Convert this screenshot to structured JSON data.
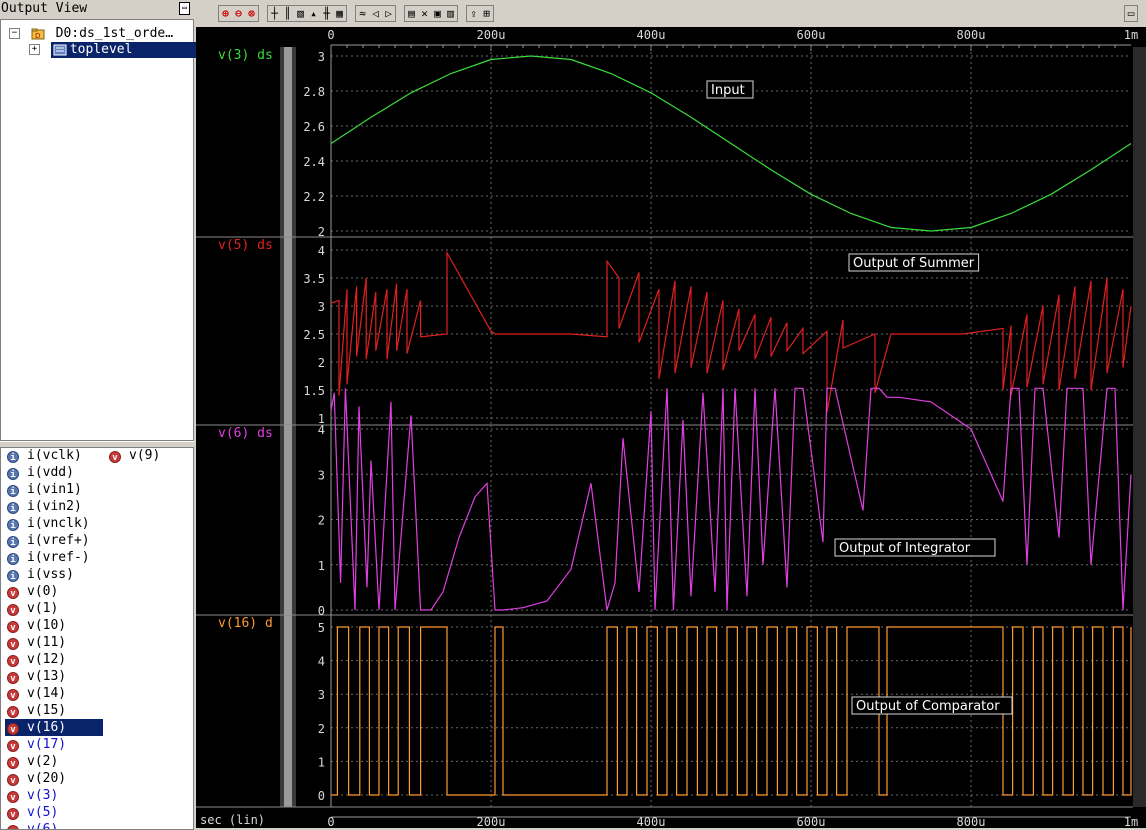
{
  "output_view": {
    "title": "Output View",
    "tree": {
      "root_label": "D0:ds_1st_orde…",
      "child_label": "toplevel"
    }
  },
  "signals": [
    {
      "type": "i",
      "label": "i(vclk)"
    },
    {
      "type": "i",
      "label": "i(vdd)"
    },
    {
      "type": "i",
      "label": "i(vin1)"
    },
    {
      "type": "i",
      "label": "i(vin2)"
    },
    {
      "type": "i",
      "label": "i(vnclk)"
    },
    {
      "type": "i",
      "label": "i(vref+)"
    },
    {
      "type": "i",
      "label": "i(vref-)"
    },
    {
      "type": "i",
      "label": "i(vss)"
    },
    {
      "type": "v",
      "label": "v(0)"
    },
    {
      "type": "v",
      "label": "v(1)"
    },
    {
      "type": "v",
      "label": "v(10)"
    },
    {
      "type": "v",
      "label": "v(11)"
    },
    {
      "type": "v",
      "label": "v(12)"
    },
    {
      "type": "v",
      "label": "v(13)"
    },
    {
      "type": "v",
      "label": "v(14)"
    },
    {
      "type": "v",
      "label": "v(15)"
    },
    {
      "type": "v",
      "label": "v(16)",
      "selected": true
    },
    {
      "type": "v",
      "label": "v(17)",
      "blue": true
    },
    {
      "type": "v",
      "label": "v(2)"
    },
    {
      "type": "v",
      "label": "v(20)"
    },
    {
      "type": "v",
      "label": "v(3)",
      "blue": true
    },
    {
      "type": "v",
      "label": "v(5)",
      "blue": true
    },
    {
      "type": "v",
      "label": "v(6)",
      "blue": true
    }
  ],
  "extra_signal": {
    "type": "v",
    "label": "v(9)"
  },
  "toolbar": {
    "groups": [
      {
        "icons": [
          "zoom-in-icon",
          "zoom-out-icon",
          "zoom-fit-icon"
        ]
      },
      {
        "icons": [
          "cursor-icon",
          "measure-icon",
          "marker-icon",
          "delta-icon",
          "probe-icon",
          "grid-icon"
        ]
      },
      {
        "icons": [
          "wave-icon",
          "left-arrow-icon",
          "right-arrow-icon"
        ]
      },
      {
        "icons": [
          "print-icon",
          "delete-icon",
          "layout-icon",
          "split-icon"
        ]
      },
      {
        "icons": [
          "export-icon",
          "fit-window-icon"
        ]
      }
    ]
  },
  "x_axis": {
    "tick_labels": [
      "0",
      "200u",
      "400u",
      "600u",
      "800u",
      "1m"
    ],
    "unit_label": "sec (lin)"
  },
  "chart_data": [
    {
      "type": "line",
      "panel_label": "v(3) ds",
      "annotation": "Input",
      "color": "#3cdc3c",
      "x_range": [
        0,
        0.001
      ],
      "ylim": [
        2,
        3
      ],
      "y_ticks": [
        "3",
        "2.8",
        "2.6",
        "2.4",
        "2.2",
        "2"
      ],
      "series": [
        {
          "x": [
            0,
            5e-05,
            0.0001,
            0.00015,
            0.0002,
            0.00025,
            0.0003,
            0.00035,
            0.0004,
            0.00045,
            0.0005,
            0.00055,
            0.0006,
            0.00065,
            0.0007,
            0.00075,
            0.0008,
            0.00085,
            0.0009,
            0.00095,
            0.001
          ],
          "values": [
            2.5,
            2.65,
            2.79,
            2.9,
            2.98,
            3.0,
            2.98,
            2.9,
            2.79,
            2.65,
            2.5,
            2.35,
            2.21,
            2.1,
            2.02,
            2.0,
            2.02,
            2.1,
            2.21,
            2.35,
            2.5
          ]
        }
      ]
    },
    {
      "type": "line",
      "panel_label": "v(5) ds",
      "annotation": "Output of Summer",
      "color": "#e02020",
      "x_range": [
        0,
        0.001
      ],
      "ylim": [
        1,
        4
      ],
      "y_ticks": [
        "4",
        "3.5",
        "3",
        "2.5",
        "2",
        "1.5",
        "1"
      ],
      "series": [
        {
          "x": [
            0,
            1e-05,
            1e-05,
            2e-05,
            2e-05,
            3.2e-05,
            3.2e-05,
            4.4e-05,
            4.4e-05,
            5.6e-05,
            5.6e-05,
            7e-05,
            7e-05,
            8.2e-05,
            8.2e-05,
            9.5e-05,
            9.5e-05,
            0.000112,
            0.000112,
            0.000145,
            0.000145,
            0.0002,
            0.000205,
            0.000205,
            0.00024,
            0.0003,
            0.000345,
            0.000345,
            0.00036,
            0.00036,
            0.000385,
            0.000385,
            0.00041,
            0.00041,
            0.00043,
            0.00043,
            0.00045,
            0.00045,
            0.00047,
            0.00047,
            0.00049,
            0.00049,
            0.00051,
            0.00051,
            0.00053,
            0.00053,
            0.00055,
            0.00055,
            0.00057,
            0.00057,
            0.00059,
            0.00059,
            0.00062,
            0.00062,
            0.00064,
            0.00064,
            0.00068,
            0.00068,
            0.0007,
            0.00079,
            0.00084,
            0.00084,
            0.00085,
            0.00085,
            0.00087,
            0.00087,
            0.00089,
            0.00089,
            0.00091,
            0.00091,
            0.00093,
            0.00093,
            0.00095,
            0.00095,
            0.00097,
            0.00097,
            0.00099,
            0.00099,
            0.001
          ],
          "values": [
            3.05,
            3.1,
            1.4,
            3.3,
            1.6,
            3.35,
            2.1,
            3.5,
            2.05,
            3.25,
            2.2,
            3.3,
            2.05,
            3.4,
            2.2,
            3.3,
            2.15,
            3.1,
            2.45,
            2.5,
            3.95,
            2.55,
            2.5,
            2.5,
            2.5,
            2.5,
            2.45,
            3.8,
            3.5,
            2.6,
            3.6,
            2.35,
            3.3,
            1.7,
            3.45,
            1.8,
            3.35,
            1.9,
            3.25,
            1.8,
            3.1,
            1.85,
            2.95,
            2.2,
            2.85,
            2.05,
            2.8,
            2.1,
            2.7,
            2.2,
            2.6,
            2.15,
            2.55,
            1.1,
            2.75,
            2.25,
            2.5,
            1.45,
            2.5,
            2.5,
            2.6,
            1.5,
            2.65,
            1.4,
            2.85,
            1.55,
            3.0,
            1.6,
            3.2,
            1.5,
            3.35,
            1.7,
            3.45,
            1.5,
            3.5,
            1.8,
            3.3,
            1.9,
            3.0
          ]
        }
      ]
    },
    {
      "type": "line",
      "panel_label": "v(6) ds",
      "annotation": "Output of Integrator",
      "color": "#e040e0",
      "x_range": [
        0,
        0.001
      ],
      "ylim": [
        0,
        5
      ],
      "y_ticks": [
        "4",
        "3",
        "2",
        "1",
        "0"
      ],
      "series": [
        {
          "x": [
            0,
            4e-06,
            1.2e-05,
            1.8e-05,
            3e-05,
            3.5e-05,
            4.5e-05,
            5e-05,
            6e-05,
            7.5e-05,
            8e-05,
            0.0001,
            0.000112,
            0.000125,
            0.00014,
            0.00016,
            0.00018,
            0.000195,
            0.000205,
            0.000215,
            0.00024,
            0.00027,
            0.0003,
            0.000325,
            0.000345,
            0.000355,
            0.000365,
            0.000385,
            0.0004,
            0.000405,
            0.00042,
            0.000428,
            0.00044,
            0.00045,
            0.000465,
            0.00048,
            0.00049,
            0.000495,
            0.000505,
            0.00052,
            0.00053,
            0.00054,
            0.000555,
            0.00057,
            0.00058,
            0.00059,
            0.000615,
            0.00062,
            0.00063,
            0.000665,
            0.000675,
            0.000685,
            0.000695,
            0.00071,
            0.00075,
            0.0008,
            0.00084,
            0.00085,
            0.00086,
            0.00087,
            0.00088,
            0.00089,
            0.00091,
            0.00092,
            0.00094,
            0.00095,
            0.00097,
            0.00098,
            0.00099,
            0.001
          ],
          "values": [
            4.4,
            4.8,
            0.6,
            4.9,
            0.0,
            4.5,
            0.5,
            3.3,
            0.0,
            4.6,
            0.0,
            4.3,
            0.0,
            0.0,
            0.4,
            1.6,
            2.5,
            2.8,
            0.0,
            0.0,
            0.05,
            0.2,
            0.9,
            2.8,
            0.0,
            0.6,
            3.8,
            0.4,
            4.4,
            0.0,
            4.9,
            0.0,
            4.2,
            0.3,
            4.8,
            0.4,
            4.9,
            0.0,
            4.9,
            0.3,
            4.9,
            1.0,
            4.9,
            0.5,
            4.9,
            4.9,
            1.5,
            4.9,
            4.9,
            2.2,
            4.9,
            4.9,
            4.7,
            4.7,
            4.6,
            4.0,
            2.4,
            4.9,
            4.9,
            1.0,
            4.9,
            4.9,
            1.6,
            4.9,
            4.9,
            1.0,
            4.9,
            4.9,
            0.0,
            3.0
          ]
        }
      ]
    },
    {
      "type": "line",
      "panel_label": "v(16) d",
      "annotation": "Output of Comparator",
      "color": "#ff9a2e",
      "x_range": [
        0,
        0.001
      ],
      "ylim": [
        0,
        5
      ],
      "y_ticks": [
        "5",
        "4",
        "3",
        "2",
        "1",
        "0"
      ],
      "pulse_edges": [
        8e-06,
        2.2e-05,
        3.6e-05,
        4.8e-05,
        6e-05,
        7.2e-05,
        8.4e-05,
        9.8e-05,
        0.000112,
        0.000145,
        0.000205,
        0.000215,
        0.000345,
        0.000358,
        0.00037,
        0.000382,
        0.000395,
        0.000408,
        0.00042,
        0.000432,
        0.000445,
        0.000458,
        0.00047,
        0.000482,
        0.000495,
        0.000508,
        0.00052,
        0.000532,
        0.000545,
        0.000558,
        0.00057,
        0.000582,
        0.000595,
        0.000608,
        0.00062,
        0.000632,
        0.000645,
        0.000685,
        0.000695,
        0.00084,
        0.000852,
        0.000865,
        0.000878,
        0.00089,
        0.000902,
        0.000915,
        0.000928,
        0.00094,
        0.000952,
        0.000965,
        0.000978,
        0.00099,
        0.001
      ]
    }
  ]
}
